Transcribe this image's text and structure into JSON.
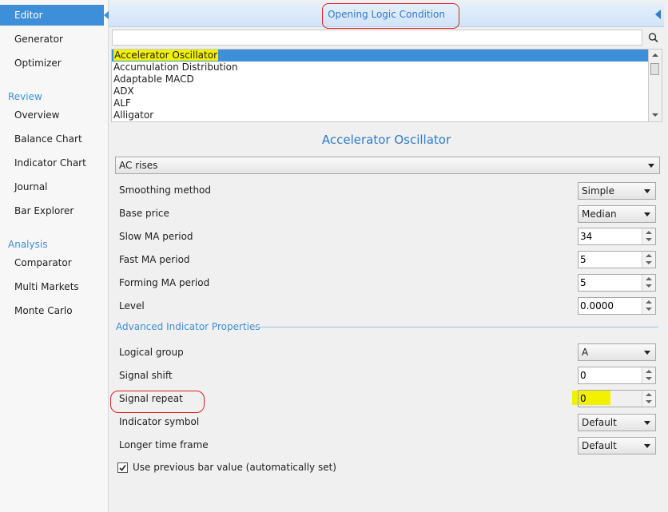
{
  "sidebar": {
    "items": [
      {
        "label": "Editor",
        "active": true
      },
      {
        "label": "Generator"
      },
      {
        "label": "Optimizer"
      }
    ],
    "review_title": "Review",
    "review_items": [
      "Overview",
      "Balance Chart",
      "Indicator Chart",
      "Journal",
      "Bar Explorer"
    ],
    "analysis_title": "Analysis",
    "analysis_items": [
      "Comparator",
      "Multi Markets",
      "Monte Carlo"
    ]
  },
  "header": {
    "title": "Opening Logic Condition"
  },
  "search": {
    "value": "",
    "placeholder": ""
  },
  "indicator_list": {
    "items": [
      "Accelerator Oscillator",
      "Accumulation Distribution",
      "Adaptable MACD",
      "ADX",
      "ALF",
      "Alligator"
    ],
    "selected_index": 0
  },
  "indicator": {
    "title": "Accelerator Oscillator",
    "logic": "AC rises",
    "params": [
      {
        "label": "Smoothing method",
        "type": "combo",
        "value": "Simple"
      },
      {
        "label": "Base price",
        "type": "combo",
        "value": "Median"
      },
      {
        "label": "Slow MA period",
        "type": "spin",
        "value": "34"
      },
      {
        "label": "Fast MA period",
        "type": "spin",
        "value": "5"
      },
      {
        "label": "Forming MA period",
        "type": "spin",
        "value": "5"
      },
      {
        "label": "Level",
        "type": "spin",
        "value": "0.0000"
      }
    ],
    "advanced_title": "Advanced Indicator Properties",
    "advanced": [
      {
        "label": "Logical group",
        "type": "combo",
        "value": "A"
      },
      {
        "label": "Signal shift",
        "type": "spin",
        "value": "0"
      },
      {
        "label": "Signal repeat",
        "type": "spin",
        "value": "0"
      },
      {
        "label": "Indicator symbol",
        "type": "combo",
        "value": "Default"
      },
      {
        "label": "Longer time frame",
        "type": "combo",
        "value": "Default"
      }
    ],
    "use_previous_bar": {
      "label": "Use previous bar value (automatically set)",
      "checked": true
    }
  },
  "colors": {
    "accent": "#3c8fd8",
    "annotation": "#e0201b",
    "highlight": "#f2f200"
  }
}
